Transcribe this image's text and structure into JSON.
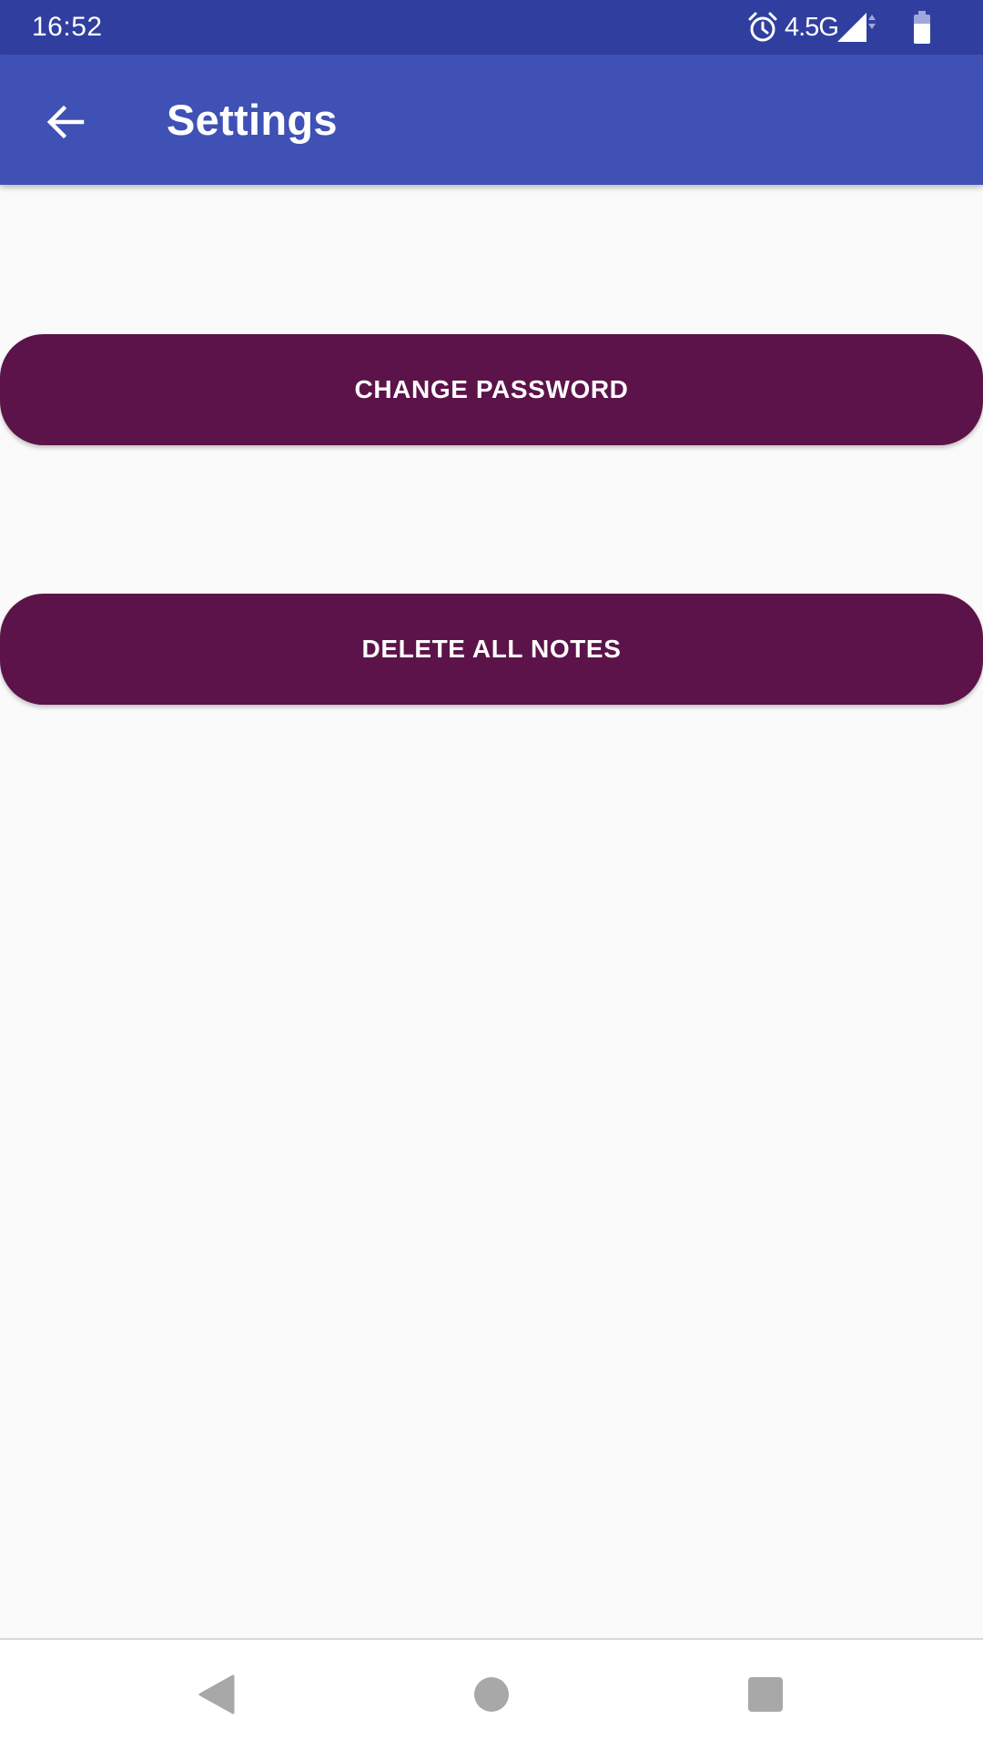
{
  "status_bar": {
    "time": "16:52",
    "network": "4.5G",
    "icons": [
      "alarm-icon",
      "signal-icon",
      "battery-icon"
    ],
    "background_color": "#303f9f"
  },
  "app_bar": {
    "title": "Settings",
    "back_icon": "arrow-back-icon",
    "background_color": "#3f51b5"
  },
  "settings": {
    "change_password_label": "CHANGE PASSWORD",
    "delete_all_notes_label": "DELETE ALL NOTES",
    "button_color": "#5c1349"
  },
  "nav_bar": {
    "icons": [
      "back-triangle-icon",
      "home-circle-icon",
      "recents-square-icon"
    ]
  }
}
